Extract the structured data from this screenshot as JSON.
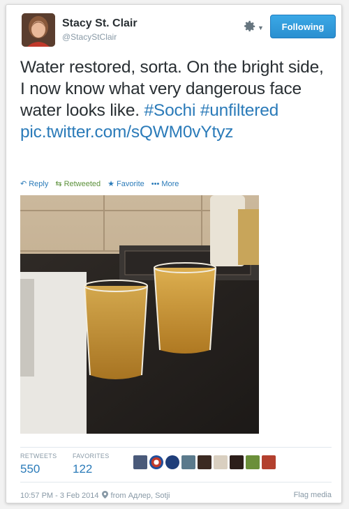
{
  "user": {
    "name": "Stacy St. Clair",
    "handle": "@StacyStClair"
  },
  "follow_button": {
    "label": "Following",
    "color": "#2a8fd0"
  },
  "tweet": {
    "text": "Water restored, sorta. On the bright side, I now know what very dangerous face water looks like.",
    "hashtags": [
      "#Sochi",
      "#unfiltered"
    ],
    "link": "pic.twitter.com/sQWM0vYtyz"
  },
  "actions": {
    "reply": "Reply",
    "retweet": "Retweeted",
    "favorite": "Favorite",
    "more": "More"
  },
  "stats": {
    "retweets_label": "RETWEETS",
    "retweets": "550",
    "favorites_label": "FAVORITES",
    "favorites": "122"
  },
  "footer": {
    "timestamp": "10:57 PM - 3 Feb 2014",
    "location": "from Адлер, Sotji",
    "flag": "Flag media"
  },
  "colors": {
    "link": "#2b7bb9",
    "text": "#292f33",
    "muted": "#8899a6",
    "retweet_green": "#5c913b"
  }
}
